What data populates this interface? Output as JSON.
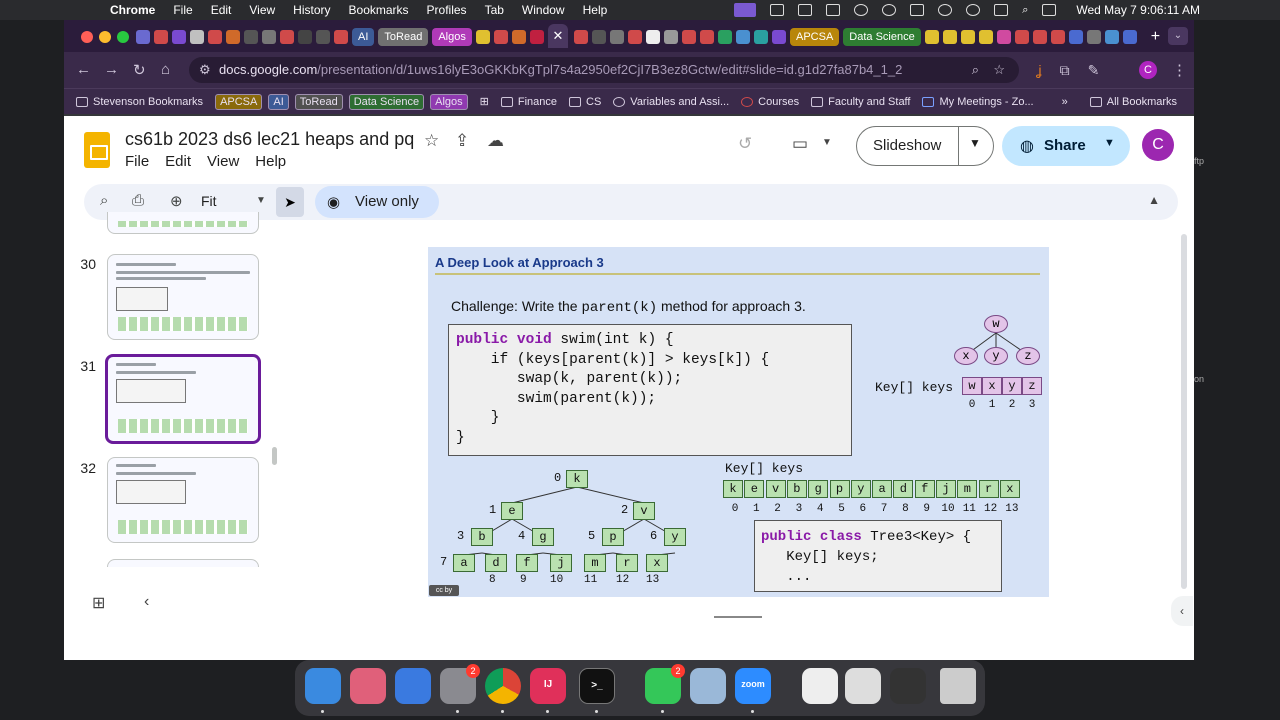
{
  "menubar": {
    "app": "Chrome",
    "items": [
      "File",
      "Edit",
      "View",
      "History",
      "Bookmarks",
      "Profiles",
      "Tab",
      "Window",
      "Help"
    ],
    "clock": "Wed May 7  9:06:11 AM"
  },
  "tabs": {
    "pills": [
      {
        "label": "AI",
        "color": "#3c5a96"
      },
      {
        "label": "ToRead",
        "color": "#707070"
      },
      {
        "label": "Algos",
        "color": "#b03ab8"
      },
      {
        "label": "APCSA",
        "color": "#b8860b"
      },
      {
        "label": "Data Science",
        "color": "#2e7d32"
      }
    ],
    "active_close": "✕",
    "new_tab": "+"
  },
  "toolbar": {
    "url_host": "docs.google.com",
    "url_path": "/presentation/d/1uws16lyE3oGKKbKgTpl7s4a2950ef2CjI7B3ez8Gctw/edit#slide=id.g1d27fa87b4_1_2",
    "profile": "C"
  },
  "bookmarks": [
    {
      "label": "Stevenson Bookmarks",
      "type": "folder"
    },
    {
      "label": "APCSA",
      "type": "pill"
    },
    {
      "label": "AI",
      "type": "pill"
    },
    {
      "label": "ToRead",
      "type": "pill"
    },
    {
      "label": "Data Science",
      "type": "pill"
    },
    {
      "label": "Algos",
      "type": "pill"
    },
    {
      "label": "Finance",
      "type": "folder"
    },
    {
      "label": "CS",
      "type": "folder"
    },
    {
      "label": "Variables and Assi...",
      "type": "link"
    },
    {
      "label": "Courses",
      "type": "link"
    },
    {
      "label": "Faculty and Staff",
      "type": "link"
    },
    {
      "label": "My Meetings - Zo...",
      "type": "link"
    },
    {
      "label": "»",
      "type": "more"
    },
    {
      "label": "All Bookmarks",
      "type": "folder"
    }
  ],
  "docs": {
    "title": "cs61b 2023 ds6 lec21 heaps and pq",
    "menu": [
      "File",
      "Edit",
      "View",
      "Help"
    ],
    "slideshow": "Slideshow",
    "share": "Share",
    "avatar": "C",
    "zoom": "Fit",
    "view_only": "View only"
  },
  "filmstrip": {
    "slides": [
      {
        "num": "30",
        "selected": false
      },
      {
        "num": "31",
        "selected": true
      },
      {
        "num": "32",
        "selected": false
      }
    ]
  },
  "slide": {
    "title": "A Deep Look at Approach 3",
    "challenge_prefix": "Challenge: Write the ",
    "challenge_code": "parent(k)",
    "challenge_suffix": " method for approach 3.",
    "code_lines": [
      [
        "kw:public",
        " ",
        "kw:void",
        " swim(int k) {"
      ],
      [
        "    if (keys[parent(k)] > keys[k]) {"
      ],
      [
        "       swap(k, parent(k));"
      ],
      [
        "       swim(parent(k));"
      ],
      [
        "    }"
      ],
      [
        "}"
      ]
    ],
    "class_lines": [
      [
        "kw:public",
        " ",
        "kw:class",
        " Tree3<Key> {"
      ],
      [
        "   Key[] keys;"
      ],
      [
        "   ..."
      ]
    ],
    "small_array_label": "Key[] keys",
    "small_array": [
      "w",
      "x",
      "y",
      "z"
    ],
    "small_indices": [
      "0",
      "1",
      "2",
      "3"
    ],
    "small_tree": {
      "root": "w",
      "children": [
        "x",
        "y",
        "z"
      ]
    },
    "big_array_label": "Key[] keys",
    "big_array": [
      "k",
      "e",
      "v",
      "b",
      "g",
      "p",
      "y",
      "a",
      "d",
      "f",
      "j",
      "m",
      "r",
      "x"
    ],
    "big_indices": [
      "0",
      "1",
      "2",
      "3",
      "4",
      "5",
      "6",
      "7",
      "8",
      "9",
      "10",
      "11",
      "12",
      "13"
    ],
    "cc": "cc by"
  },
  "dock": {
    "badges": {
      "settings": "2",
      "messages": "2"
    },
    "zoom_label": "zoom",
    "terminal_label": ">_",
    "ij_label": "IJ"
  }
}
